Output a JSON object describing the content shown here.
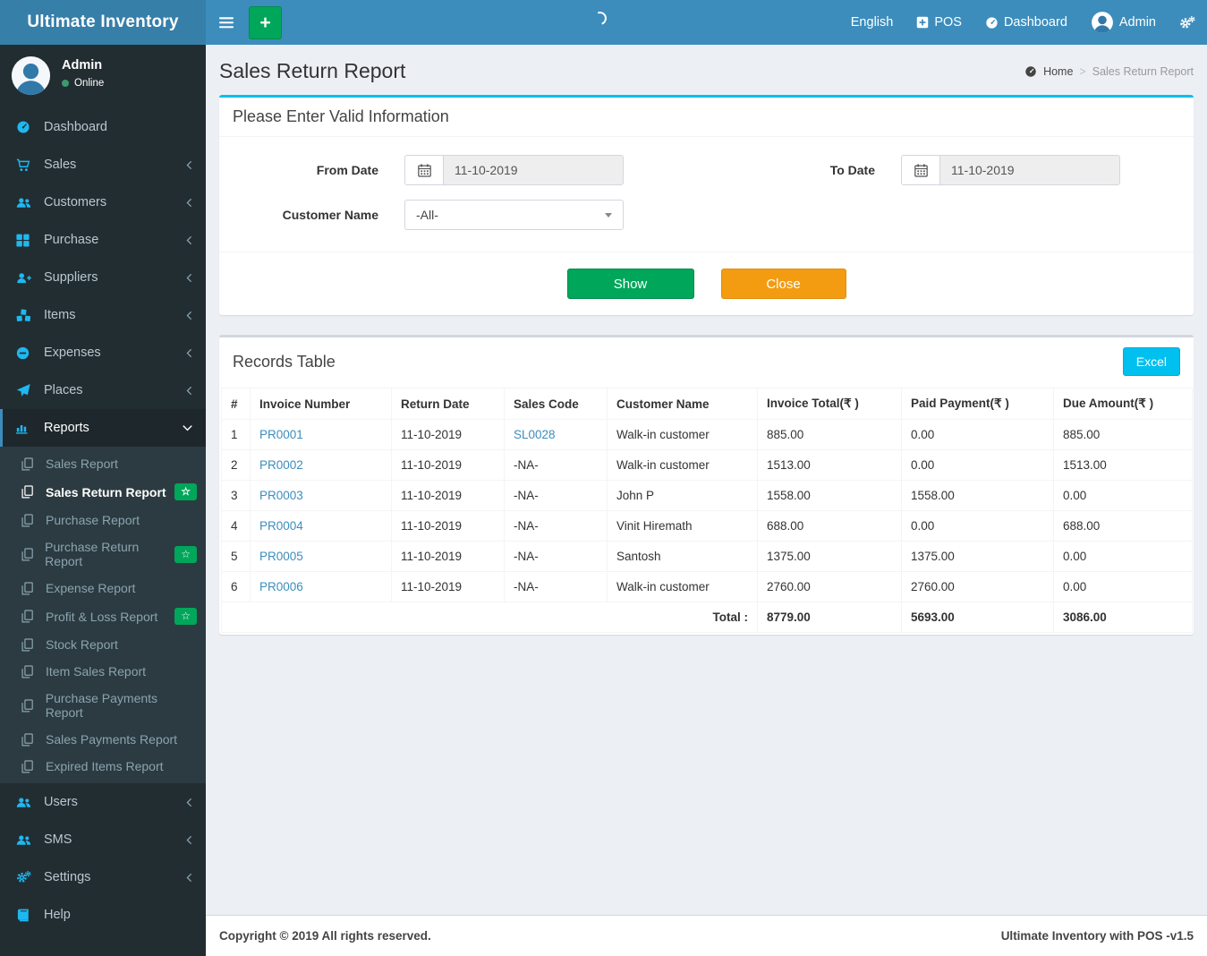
{
  "app": {
    "title": "Ultimate Inventory",
    "version_note": "Ultimate Inventory with POS -v1.5",
    "copyright": "Copyright © 2019 All rights reserved."
  },
  "colors": {
    "navbar": "#3c8dbc",
    "logo_bg": "#367fa9",
    "sidebar": "#222d32",
    "submenu_bg": "#2c3b41",
    "success": "#00a65a",
    "warning": "#f39c12",
    "info": "#00c0ef",
    "link": "#3c8dbc",
    "content_bg": "#ecf0f5",
    "sidebar_icon": "#1eb8f0"
  },
  "navbar": {
    "language": "English",
    "pos": "POS",
    "dashboard": "Dashboard",
    "user": "Admin",
    "add_label": "+"
  },
  "user_panel": {
    "name": "Admin",
    "status": "Online"
  },
  "sidebar": {
    "badge_star": "☆",
    "items": [
      {
        "label": "Dashboard"
      },
      {
        "label": "Sales"
      },
      {
        "label": "Customers"
      },
      {
        "label": "Purchase"
      },
      {
        "label": "Suppliers"
      },
      {
        "label": "Items"
      },
      {
        "label": "Expenses"
      },
      {
        "label": "Places"
      },
      {
        "label": "Reports"
      },
      {
        "label": "Users"
      },
      {
        "label": "SMS"
      },
      {
        "label": "Settings"
      },
      {
        "label": "Help"
      }
    ],
    "reports_submenu": [
      {
        "label": "Sales Report",
        "badge": false,
        "active": false
      },
      {
        "label": "Sales Return Report",
        "badge": true,
        "active": true
      },
      {
        "label": "Purchase Report",
        "badge": false,
        "active": false
      },
      {
        "label": "Purchase Return Report",
        "badge": true,
        "active": false
      },
      {
        "label": "Expense Report",
        "badge": false,
        "active": false
      },
      {
        "label": "Profit & Loss Report",
        "badge": true,
        "active": false
      },
      {
        "label": "Stock Report",
        "badge": false,
        "active": false
      },
      {
        "label": "Item Sales Report",
        "badge": false,
        "active": false
      },
      {
        "label": "Purchase Payments Report",
        "badge": false,
        "active": false
      },
      {
        "label": "Sales Payments Report",
        "badge": false,
        "active": false
      },
      {
        "label": "Expired Items Report",
        "badge": false,
        "active": false
      }
    ]
  },
  "page": {
    "title": "Sales Return Report",
    "breadcrumb_home": "Home",
    "breadcrumb_sep": ">",
    "breadcrumb_current": "Sales Return Report"
  },
  "filter_box": {
    "heading": "Please Enter Valid Information",
    "from_label": "From Date",
    "from_value": "11-10-2019",
    "to_label": "To Date",
    "to_value": "11-10-2019",
    "customer_label": "Customer Name",
    "customer_value": "-All-",
    "show_label": "Show",
    "close_label": "Close"
  },
  "records": {
    "heading": "Records Table",
    "excel_label": "Excel",
    "columns": [
      "#",
      "Invoice Number",
      "Return Date",
      "Sales Code",
      "Customer Name",
      "Invoice Total(₹ )",
      "Paid Payment(₹ )",
      "Due Amount(₹ )"
    ],
    "rows": [
      {
        "num": "1",
        "invoice": "PR0001",
        "return_date": "11-10-2019",
        "sales_code": "SL0028",
        "sales_code_is_link": true,
        "customer": "Walk-in customer",
        "invoice_total": "885.00",
        "paid": "0.00",
        "due": "885.00"
      },
      {
        "num": "2",
        "invoice": "PR0002",
        "return_date": "11-10-2019",
        "sales_code": "-NA-",
        "sales_code_is_link": false,
        "customer": "Walk-in customer",
        "invoice_total": "1513.00",
        "paid": "0.00",
        "due": "1513.00"
      },
      {
        "num": "3",
        "invoice": "PR0003",
        "return_date": "11-10-2019",
        "sales_code": "-NA-",
        "sales_code_is_link": false,
        "customer": "John P",
        "invoice_total": "1558.00",
        "paid": "1558.00",
        "due": "0.00"
      },
      {
        "num": "4",
        "invoice": "PR0004",
        "return_date": "11-10-2019",
        "sales_code": "-NA-",
        "sales_code_is_link": false,
        "customer": "Vinit Hiremath",
        "invoice_total": "688.00",
        "paid": "0.00",
        "due": "688.00"
      },
      {
        "num": "5",
        "invoice": "PR0005",
        "return_date": "11-10-2019",
        "sales_code": "-NA-",
        "sales_code_is_link": false,
        "customer": "Santosh",
        "invoice_total": "1375.00",
        "paid": "1375.00",
        "due": "0.00"
      },
      {
        "num": "6",
        "invoice": "PR0006",
        "return_date": "11-10-2019",
        "sales_code": "-NA-",
        "sales_code_is_link": false,
        "customer": "Walk-in customer",
        "invoice_total": "2760.00",
        "paid": "2760.00",
        "due": "0.00"
      }
    ],
    "total_label": "Total :",
    "totals": {
      "invoice_total": "8779.00",
      "paid_payment": "5693.00",
      "due_amount": "3086.00"
    }
  }
}
